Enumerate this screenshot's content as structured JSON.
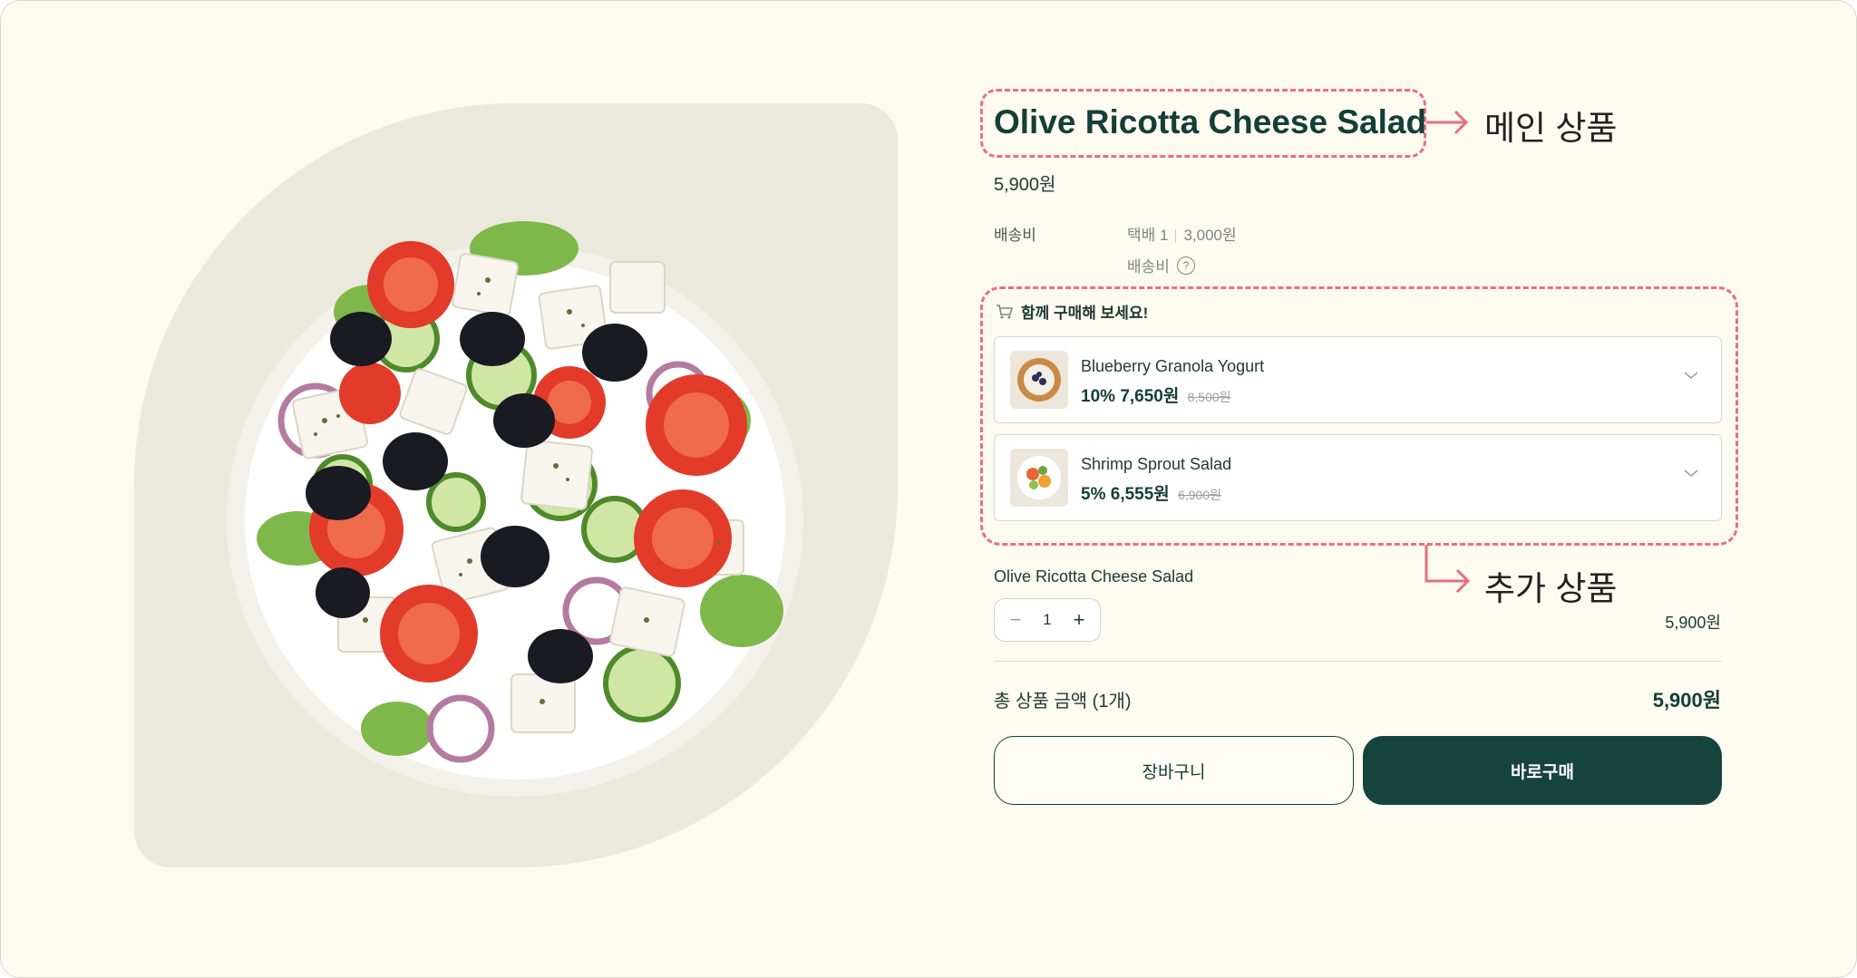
{
  "product": {
    "title": "Olive Ricotta Cheese Salad",
    "price": "5,900원"
  },
  "shipping": {
    "label": "배송비",
    "method": "택배 1",
    "fee": "3,000원",
    "sub_label": "배송비",
    "help_icon": "question-circle-icon"
  },
  "annotations": {
    "main": "메인 상품",
    "addon": "추가 상품"
  },
  "addon": {
    "heading": "함께 구매해 보세요!",
    "heading_icon": "cart-icon",
    "items": [
      {
        "name": "Blueberry Granola Yogurt",
        "discount": "10%",
        "price": "7,650원",
        "original": "8,500원"
      },
      {
        "name": "Shrimp Sprout Salad",
        "discount": "5%",
        "price": "6,555원",
        "original": "6,900원"
      }
    ]
  },
  "selected": {
    "name": "Olive Ricotta Cheese Salad",
    "quantity": "1",
    "price": "5,900원"
  },
  "total": {
    "label": "총 상품 금액 (1개)",
    "value": "5,900원"
  },
  "buttons": {
    "cart": "장바구니",
    "buy": "바로구매"
  },
  "colors": {
    "background": "#fdfaf0",
    "brand": "#15443d",
    "annotation": "#e8707f",
    "panel": "#ebe8dc"
  }
}
